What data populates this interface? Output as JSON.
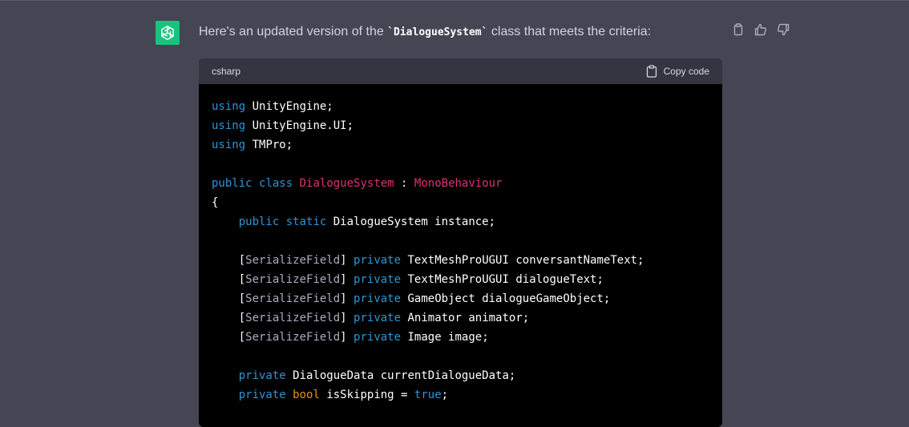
{
  "message": {
    "intro_prefix": "Here's an updated version of the ",
    "intro_code": "`DialogueSystem`",
    "intro_suffix": " class that meets the criteria:"
  },
  "avatar": {
    "icon": "openai-logo-icon",
    "color": "#19c37d"
  },
  "actions": {
    "icons": [
      "copy-icon",
      "thumbs-up-icon",
      "thumbs-down-icon"
    ]
  },
  "code_block": {
    "language": "csharp",
    "copy_label": "Copy code",
    "lines": [
      [
        {
          "t": "using",
          "c": "kw"
        },
        {
          "t": " UnityEngine;"
        }
      ],
      [
        {
          "t": "using",
          "c": "kw"
        },
        {
          "t": " UnityEngine.UI;"
        }
      ],
      [
        {
          "t": "using",
          "c": "kw"
        },
        {
          "t": " TMPro;"
        }
      ],
      [],
      [
        {
          "t": "public",
          "c": "kw"
        },
        {
          "t": " "
        },
        {
          "t": "class",
          "c": "kw"
        },
        {
          "t": " "
        },
        {
          "t": "DialogueSystem",
          "c": "typ"
        },
        {
          "t": " : "
        },
        {
          "t": "MonoBehaviour",
          "c": "typ"
        }
      ],
      [
        {
          "t": "{"
        }
      ],
      [
        {
          "t": "    "
        },
        {
          "t": "public",
          "c": "kw"
        },
        {
          "t": " "
        },
        {
          "t": "static",
          "c": "kw"
        },
        {
          "t": " DialogueSystem instance;"
        }
      ],
      [],
      [
        {
          "t": "    ["
        },
        {
          "t": "SerializeField",
          "c": "attr"
        },
        {
          "t": "] "
        },
        {
          "t": "private",
          "c": "kw"
        },
        {
          "t": " TextMeshProUGUI conversantNameText;"
        }
      ],
      [
        {
          "t": "    ["
        },
        {
          "t": "SerializeField",
          "c": "attr"
        },
        {
          "t": "] "
        },
        {
          "t": "private",
          "c": "kw"
        },
        {
          "t": " TextMeshProUGUI dialogueText;"
        }
      ],
      [
        {
          "t": "    ["
        },
        {
          "t": "SerializeField",
          "c": "attr"
        },
        {
          "t": "] "
        },
        {
          "t": "private",
          "c": "kw"
        },
        {
          "t": " GameObject dialogueGameObject;"
        }
      ],
      [
        {
          "t": "    ["
        },
        {
          "t": "SerializeField",
          "c": "attr"
        },
        {
          "t": "] "
        },
        {
          "t": "private",
          "c": "kw"
        },
        {
          "t": " Animator animator;"
        }
      ],
      [
        {
          "t": "    ["
        },
        {
          "t": "SerializeField",
          "c": "attr"
        },
        {
          "t": "] "
        },
        {
          "t": "private",
          "c": "kw"
        },
        {
          "t": " Image image;"
        }
      ],
      [],
      [
        {
          "t": "    "
        },
        {
          "t": "private",
          "c": "kw"
        },
        {
          "t": " DialogueData currentDialogueData;"
        }
      ],
      [
        {
          "t": "    "
        },
        {
          "t": "private",
          "c": "kw"
        },
        {
          "t": " "
        },
        {
          "t": "bool",
          "c": "lit"
        },
        {
          "t": " isSkipping = "
        },
        {
          "t": "true",
          "c": "kw"
        },
        {
          "t": ";"
        }
      ]
    ]
  },
  "colors": {
    "background": "#444654",
    "code_background": "#000000",
    "header_background": "#343541",
    "keyword": "#2e95d3",
    "type": "#df3079",
    "attribute": "#a9aec1",
    "literal": "#e9950c"
  }
}
